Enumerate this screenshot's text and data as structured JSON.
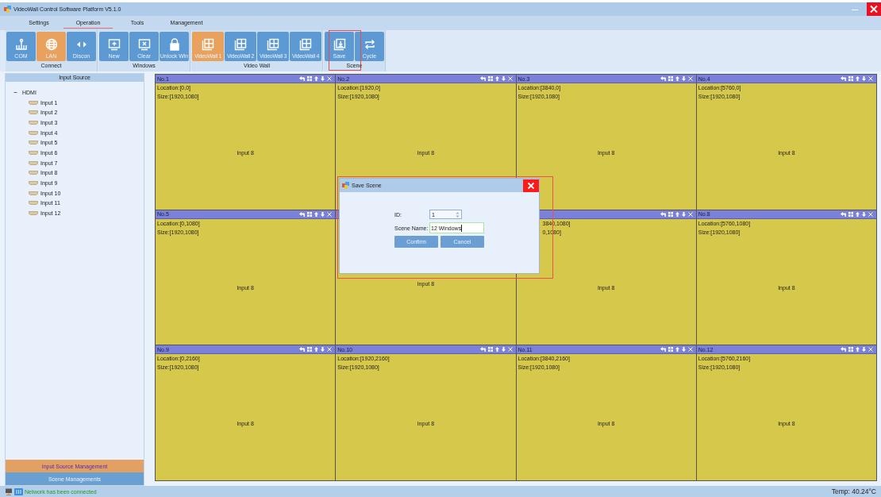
{
  "window": {
    "title": "VideoWall Control Software Platform V5.1.0"
  },
  "tabs": [
    {
      "label": "Settings",
      "selected": false
    },
    {
      "label": "Operation",
      "selected": true
    },
    {
      "label": "Tools",
      "selected": false
    },
    {
      "label": "Management",
      "selected": false
    }
  ],
  "ribbon": {
    "groups": [
      {
        "label": "Connect",
        "buttons": [
          {
            "label": "COM",
            "selected": false
          },
          {
            "label": "LAN",
            "selected": true
          },
          {
            "label": "Discon",
            "selected": false
          }
        ]
      },
      {
        "label": "Windows",
        "buttons": [
          {
            "label": "New",
            "selected": false
          },
          {
            "label": "Clear",
            "selected": false
          },
          {
            "label": "Unlock Win",
            "selected": false
          }
        ]
      },
      {
        "label": "Video Wall",
        "buttons": [
          {
            "label": "VideoWall 1",
            "selected": true
          },
          {
            "label": "VideoWall 2",
            "selected": false
          },
          {
            "label": "VideoWall 3",
            "selected": false
          },
          {
            "label": "VideoWall 4",
            "selected": false
          }
        ]
      },
      {
        "label": "Scene",
        "buttons": [
          {
            "label": "Save",
            "selected": false
          },
          {
            "label": "Cycle",
            "selected": false
          }
        ]
      }
    ]
  },
  "sidebar": {
    "header": "Input Source",
    "tree": [
      {
        "label": "HDMI",
        "expanded": true,
        "children": [
          {
            "label": "Input 1"
          },
          {
            "label": "Input 2"
          },
          {
            "label": "Input 3"
          },
          {
            "label": "Input 4"
          },
          {
            "label": "Input 5"
          },
          {
            "label": "Input 6"
          },
          {
            "label": "Input 7"
          },
          {
            "label": "Input 8"
          },
          {
            "label": "Input 9"
          },
          {
            "label": "Input 10"
          },
          {
            "label": "Input 11"
          },
          {
            "label": "Input 12"
          }
        ]
      }
    ],
    "panels": [
      {
        "label": "Input Source Management",
        "selected": true
      },
      {
        "label": "Scene Managements",
        "selected": false
      }
    ]
  },
  "video_wall": {
    "windows": [
      {
        "kind": "full",
        "title": "No.1",
        "location": "Location:[0,0]",
        "size": "Size:[1920,1080]",
        "source": "Input 8"
      },
      {
        "kind": "full",
        "title": "No.2",
        "location": "Location:[1920,0]",
        "size": "Size:[1920,1080]",
        "source": "Input 8"
      },
      {
        "kind": "full",
        "title": "No.3",
        "location": "Location:[3840,0]",
        "size": "Size:[1920,1080]",
        "source": "Input 8"
      },
      {
        "kind": "full",
        "title": "No.4",
        "location": "Location:[5760,0]",
        "size": "Size:[1920,1080]",
        "source": "Input 8"
      },
      {
        "kind": "full",
        "title": "No.5",
        "location": "Location:[0,1080]",
        "size": "Size:[1920,1080]",
        "source": "Input 8"
      },
      {
        "source": "Input 8"
      },
      {
        "kind": "right-part",
        "location": "3840,1080]",
        "size": "0,1080]",
        "source": "Input 8"
      },
      {
        "kind": "full",
        "title": "No.8",
        "location": "Location:[5760,1080]",
        "size": "Size:[1920,1080]",
        "source": "Input 8"
      },
      {
        "kind": "full",
        "title": "No.9",
        "location": "Location:[0,2160]",
        "size": "Size:[1920,1080]",
        "source": "Input 8"
      },
      {
        "kind": "full",
        "title": "No.10",
        "location": "Location:[1920,2160]",
        "size": "Size:[1920,1080]",
        "source": "Input 8"
      },
      {
        "kind": "full",
        "title": "No.11",
        "location": "Location:[3840,2160]",
        "size": "Size:[1920,1080]",
        "source": "Input 8"
      },
      {
        "kind": "full",
        "title": "No.12",
        "location": "Location:[5760,2160]",
        "size": "Size:[1920,1080]",
        "source": "Input 8"
      }
    ]
  },
  "dialog": {
    "title": "Save Scene",
    "fields": [
      {
        "kind": "spinner",
        "label": "ID:",
        "value": "1"
      },
      {
        "kind": "text",
        "label": "Scene Name:",
        "value": "12 Windows"
      }
    ],
    "buttons": [
      "Confirm",
      "Cancel"
    ]
  },
  "status_bar": {
    "message": "Network has been connected",
    "temperature": "Temp: 40.24°C"
  }
}
